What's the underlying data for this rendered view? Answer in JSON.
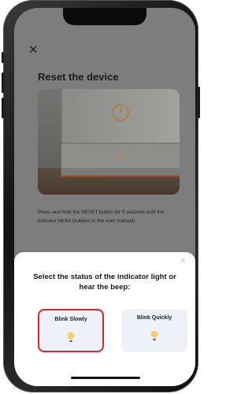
{
  "header": {
    "close_glyph": "✕"
  },
  "page": {
    "title": "Reset the device",
    "image_alt": "",
    "instructions": "Press and hold the RESET button for 5 seconds until the indicator blinks (subject to the user manual)."
  },
  "sheet": {
    "close_glyph": "✕",
    "question": "Select the status of the indicator light or hear the beep:",
    "options": [
      {
        "label": "Blink Slowly",
        "selected": true,
        "icon": "lightbulb-icon"
      },
      {
        "label": "Blink Quickly",
        "selected": false,
        "icon": "lightbulb-icon"
      }
    ]
  },
  "colors": {
    "overlay": "#7d7d7d",
    "selected_border": "#d9262d",
    "option_bg": "#eef2f8",
    "bulb": "#f6cf6a"
  }
}
